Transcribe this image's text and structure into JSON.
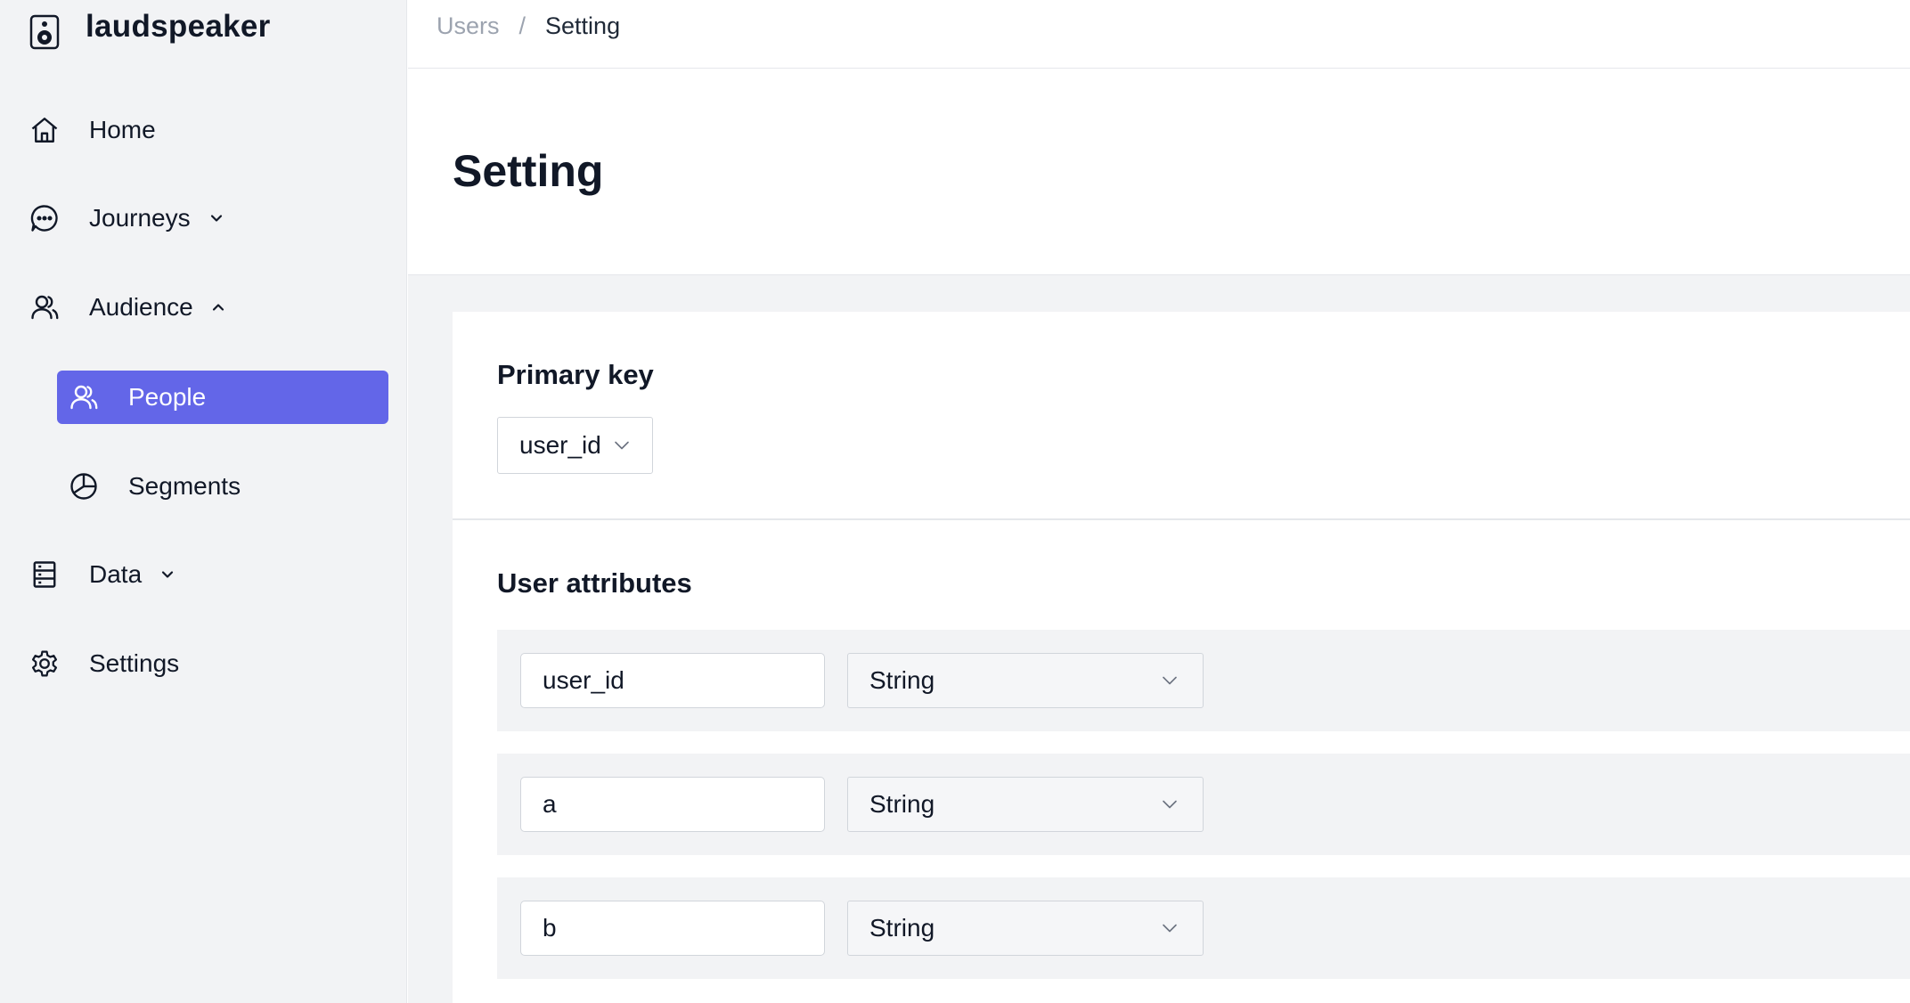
{
  "app": {
    "brand": "laudspeaker"
  },
  "sidebar": {
    "items": [
      {
        "label": "Home",
        "icon": "home-icon"
      },
      {
        "label": "Journeys",
        "icon": "chat-bubble-icon",
        "expanded": false
      },
      {
        "label": "Audience",
        "icon": "users-icon",
        "expanded": true
      },
      {
        "label": "Data",
        "icon": "database-icon",
        "expanded": false
      },
      {
        "label": "Settings",
        "icon": "gear-icon"
      }
    ],
    "audience_children": [
      {
        "label": "People",
        "icon": "users-icon",
        "active": true
      },
      {
        "label": "Segments",
        "icon": "pie-chart-icon",
        "active": false
      }
    ],
    "active_color": "#6366e8"
  },
  "breadcrumb": {
    "parent": "Users",
    "separator": "/",
    "current": "Setting"
  },
  "page": {
    "title": "Setting"
  },
  "primary_key": {
    "title": "Primary key",
    "value": "user_id"
  },
  "user_attributes": {
    "title": "User attributes",
    "rows": [
      {
        "name": "user_id",
        "type": "String"
      },
      {
        "name": "a",
        "type": "String"
      },
      {
        "name": "b",
        "type": "String"
      }
    ]
  }
}
